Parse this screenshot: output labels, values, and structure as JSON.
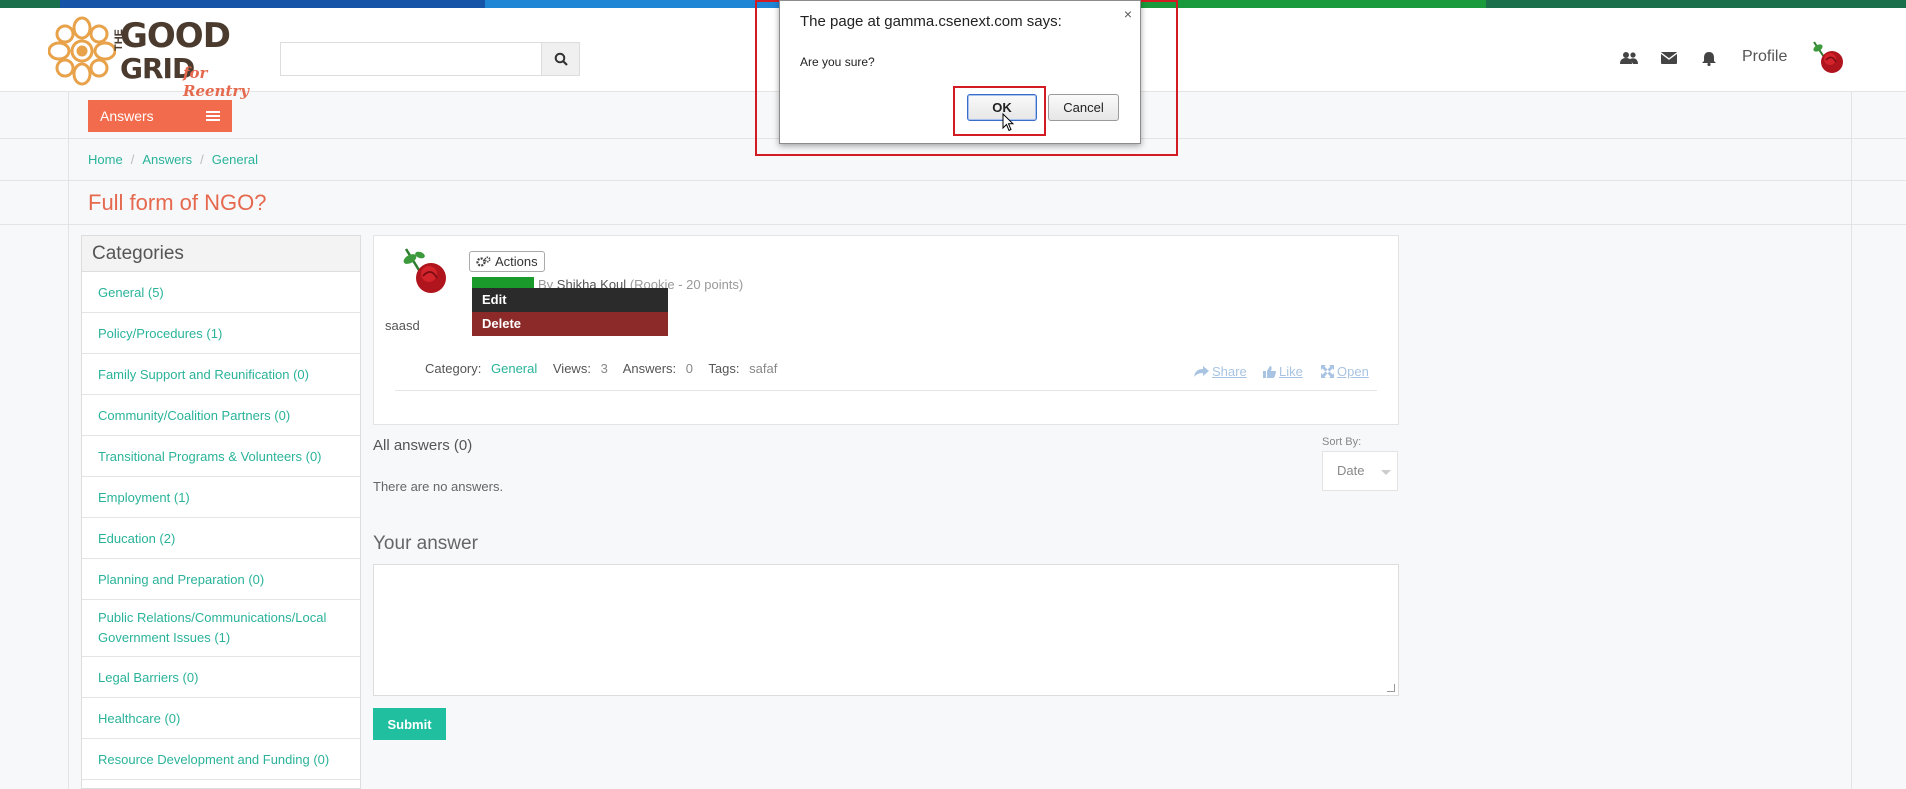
{
  "colors": {
    "strip": [
      "#1b6f4a",
      "#1554a6",
      "#1554a6",
      "#1f86d6",
      "#1f86d6",
      "#1a9a3c",
      "#1a9a3c",
      "#1b6f4a"
    ],
    "accent": "#f26b4c",
    "link": "#2ab39a",
    "submit": "#1fbf9f"
  },
  "logo": {
    "the": "THE",
    "good": "GOOD",
    "grid": "GRID",
    "for": "for Reentry"
  },
  "search": {
    "placeholder": "",
    "button_icon": "search-icon"
  },
  "header": {
    "icons": [
      "users-icon",
      "envelope-icon",
      "bell-icon"
    ],
    "profile_label": "Profile"
  },
  "nav": {
    "answers_label": "Answers"
  },
  "breadcrumb": [
    "Home",
    "Answers",
    "General"
  ],
  "page_title": "Full form of NGO?",
  "categories": {
    "heading": "Categories",
    "items": [
      "General (5)",
      "Policy/Procedures (1)",
      "Family Support and Reunification (0)",
      "Community/Coalition Partners (0)",
      "Transitional Programs & Volunteers (0)",
      "Employment (1)",
      "Education (2)",
      "Planning and Preparation (0)",
      "Public Relations/Communications/Local Government Issues (1)",
      "Legal Barriers (0)",
      "Healthcare (0)",
      "Resource Development and Funding (0)"
    ]
  },
  "question": {
    "actions_label": "Actions",
    "by_prefix": "By",
    "author": "Shikha Koul",
    "rank": "(Rookie - 20 points)",
    "menu": {
      "edit": "Edit",
      "delete": "Delete"
    },
    "body": "saasd",
    "category_label": "Category:",
    "category_value": "General",
    "views_label": "Views:",
    "views_value": "3",
    "answers_label": "Answers:",
    "answers_value": "0",
    "tags_label": "Tags:",
    "tags_value": "safaf",
    "share": "Share",
    "like": "Like",
    "open": "Open"
  },
  "answers": {
    "heading": "All answers (0)",
    "sort_label": "Sort By:",
    "sort_value": "Date",
    "empty": "There are no answers."
  },
  "your_answer": {
    "heading": "Your answer",
    "submit": "Submit"
  },
  "dialog": {
    "title": "The page at gamma.csenext.com says:",
    "message": "Are you sure?",
    "ok": "OK",
    "cancel": "Cancel",
    "close": "×"
  }
}
